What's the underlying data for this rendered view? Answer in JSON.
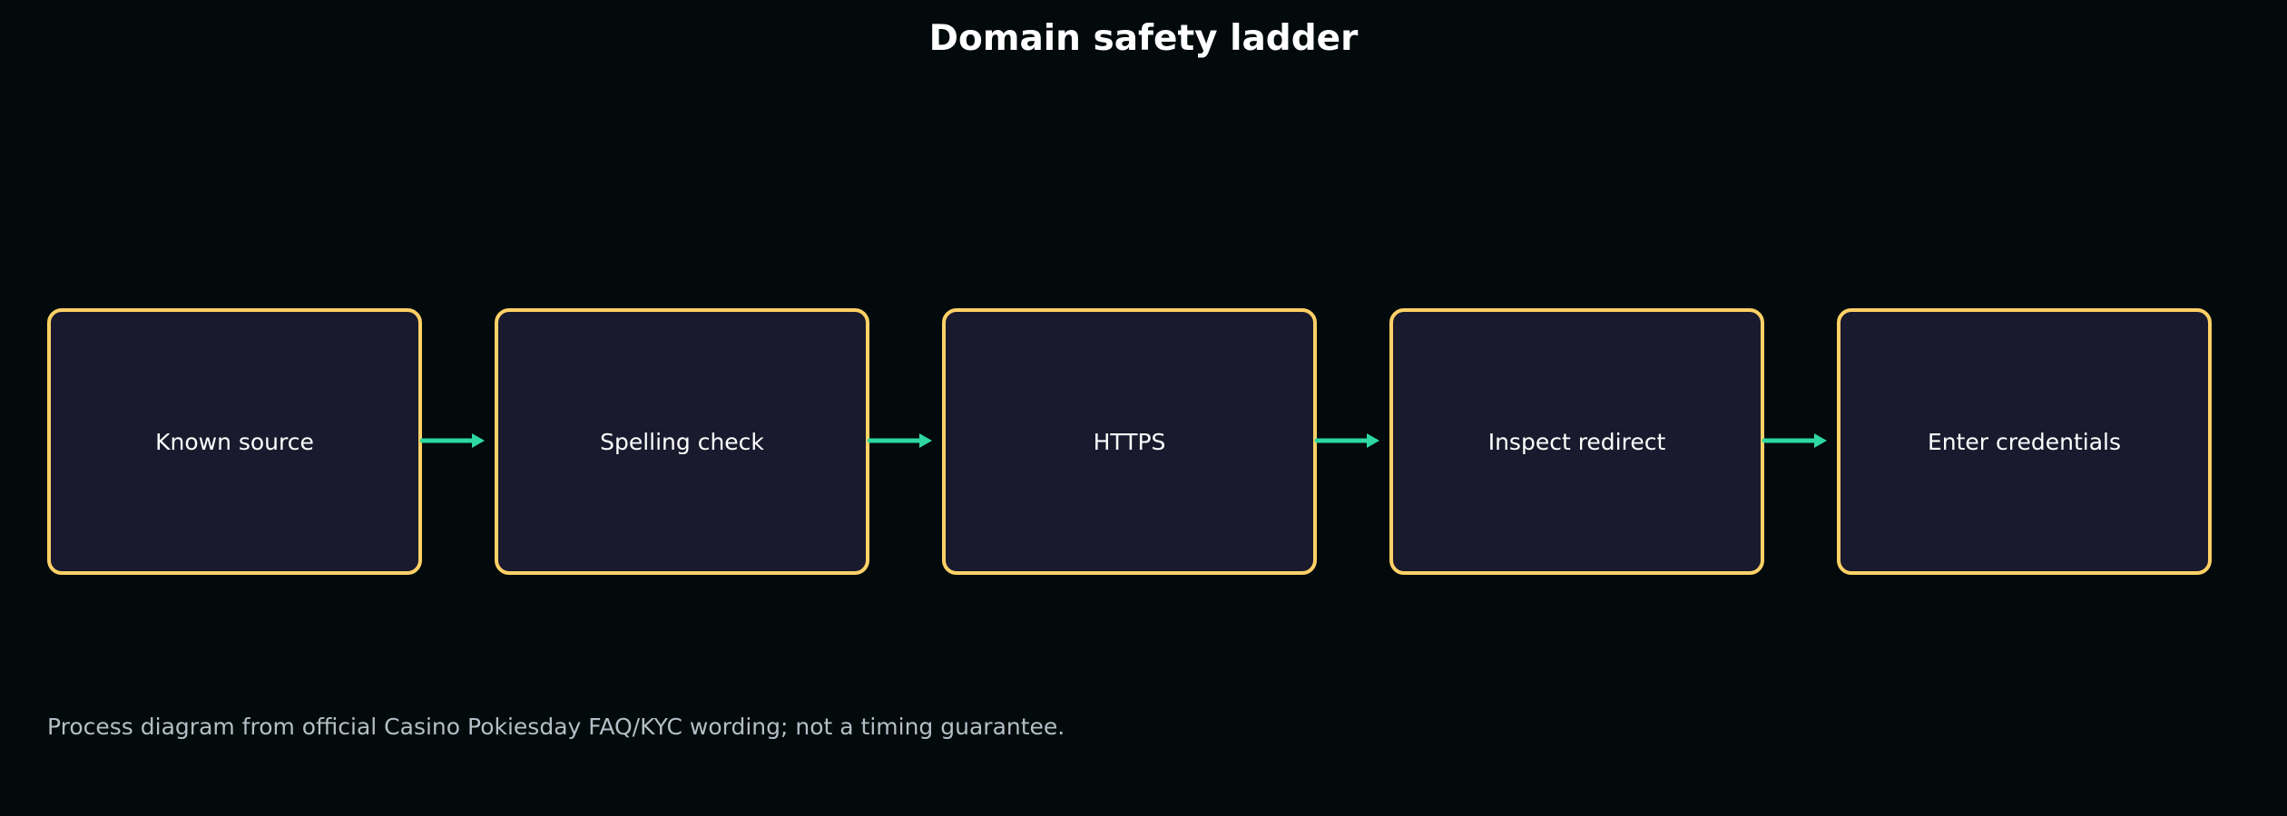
{
  "title": "Domain safety ladder",
  "steps": [
    {
      "label": "Known source"
    },
    {
      "label": "Spelling check"
    },
    {
      "label": "HTTPS"
    },
    {
      "label": "Inspect redirect"
    },
    {
      "label": "Enter credentials"
    }
  ],
  "footnote": "Process diagram from official Casino Pokiesday FAQ/KYC wording; not a timing guarantee.",
  "colors": {
    "background": "#020a0c",
    "box_border": "#ffd166",
    "box_fill": "#1a1a2e",
    "arrow": "#2ed8a0",
    "text": "#ffffff",
    "footnote": "#b4bec6"
  }
}
